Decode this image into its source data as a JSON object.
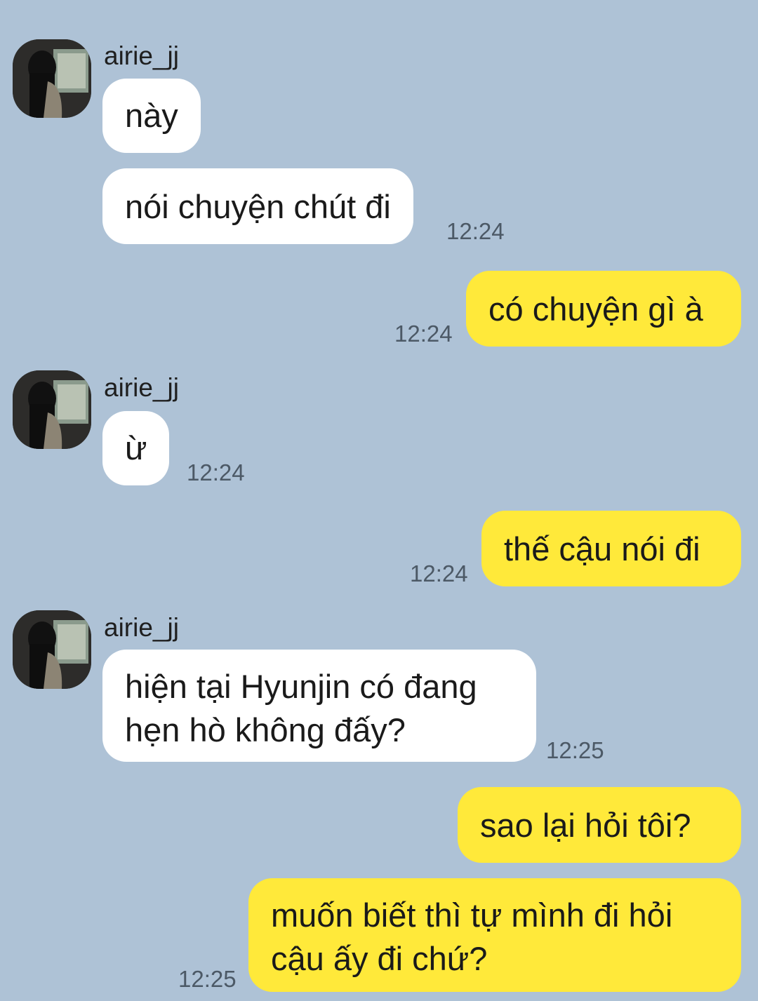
{
  "messages": [
    {
      "sender": "airie_jj",
      "text": "này"
    },
    {
      "sender": "airie_jj",
      "text": "nói chuyện chút đi",
      "time": "12:24"
    },
    {
      "sender": "me",
      "text": "có chuyện gì à",
      "time": "12:24"
    },
    {
      "sender": "airie_jj",
      "text": "ừ",
      "time": "12:24"
    },
    {
      "sender": "me",
      "text": "thế cậu nói đi",
      "time": "12:24"
    },
    {
      "sender": "airie_jj",
      "lines": [
        "hiện tại Hyunjin có đang",
        "hẹn hò không đấy?"
      ],
      "time": "12:25"
    },
    {
      "sender": "me",
      "text": "sao lại hỏi tôi?"
    },
    {
      "sender": "me",
      "lines": [
        "muốn biết thì tự mình đi hỏi",
        "cậu ấy đi chứ?"
      ],
      "time": "12:25"
    }
  ],
  "contact": {
    "name": "airie_jj"
  },
  "colors": {
    "background": "#aec2d6",
    "incoming_bubble": "#ffffff",
    "outgoing_bubble": "#ffe93a",
    "timestamp": "#4c5966"
  }
}
